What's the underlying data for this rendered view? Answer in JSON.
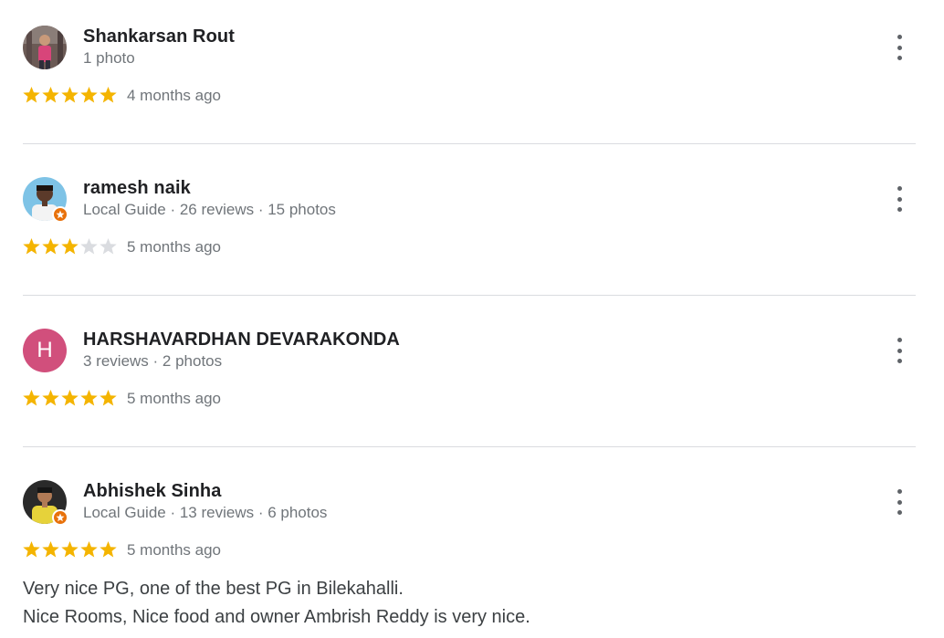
{
  "colors": {
    "star_filled": "#F4B400",
    "star_empty": "#DADCE0",
    "name_text": "#202124",
    "meta_text": "#70757A",
    "divider": "#DADCE0",
    "guide_badge": "#E8710A",
    "letter_avatar_bg": "#D14F7C"
  },
  "reviews": [
    {
      "name": "Shankarsan Rout",
      "meta": "1 photo",
      "rating": 5,
      "when": "4 months ago",
      "avatar": "photo-avatar",
      "local_guide": false
    },
    {
      "name": "ramesh naik",
      "meta": "Local Guide · 26 reviews · 15 photos",
      "rating": 3,
      "when": "5 months ago",
      "avatar": "photo-avatar",
      "local_guide": true
    },
    {
      "name": "HARSHAVARDHAN DEVARAKONDA",
      "meta": "3 reviews · 2 photos",
      "rating": 5,
      "when": "5 months ago",
      "avatar_letter": "H",
      "local_guide": false
    },
    {
      "name": "Abhishek Sinha",
      "meta": "Local Guide · 13 reviews · 6 photos",
      "rating": 5,
      "when": "5 months ago",
      "avatar": "photo-avatar",
      "local_guide": true,
      "text_lines": [
        "Very nice PG, one of the best PG in Bilekahalli.",
        "Nice Rooms, Nice food and owner Ambrish Reddy is very nice."
      ]
    }
  ],
  "icons": {
    "menu": "more-vert-icon",
    "star": "star-icon",
    "guide": "local-guide-badge-icon"
  }
}
